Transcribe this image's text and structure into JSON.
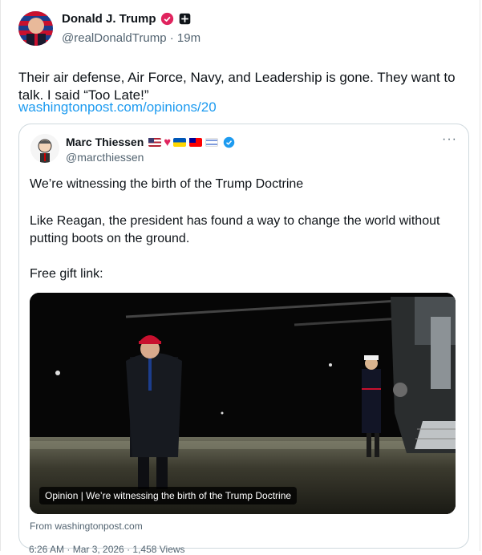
{
  "post": {
    "author_name": "Donald J. Trump",
    "handle": "@realDonaldTrump",
    "separator": "·",
    "time": "19m",
    "text": "Their air defense, Air Force, Navy, and Leadership is gone. They want to talk. I said “Too Late!”",
    "link": "washingtonpost.com/opinions/20"
  },
  "quote": {
    "author_name": "Marc Thiessen",
    "flags": [
      "us-flag",
      "red-heart",
      "ukraine-flag",
      "taiwan-flag",
      "israel-flag"
    ],
    "handle": "@marcthiessen",
    "more": "···",
    "line1": "We’re witnessing the birth of the Trump Doctrine",
    "line2": "Like Reagan, the president has found a way to change the world without putting boots on the ground.",
    "line3": "Free gift link:",
    "media_caption": "Opinion | We’re witnessing the birth of the Trump Doctrine",
    "from": "From washingtonpost.com"
  },
  "footer": {
    "meta": "6:26 AM · Mar 3, 2026 · 1,458 Views"
  },
  "colors": {
    "link": "#1d9bf0",
    "verified_gold": "#e0245e",
    "verified_blue": "#1d9bf0",
    "muted": "#536471"
  }
}
